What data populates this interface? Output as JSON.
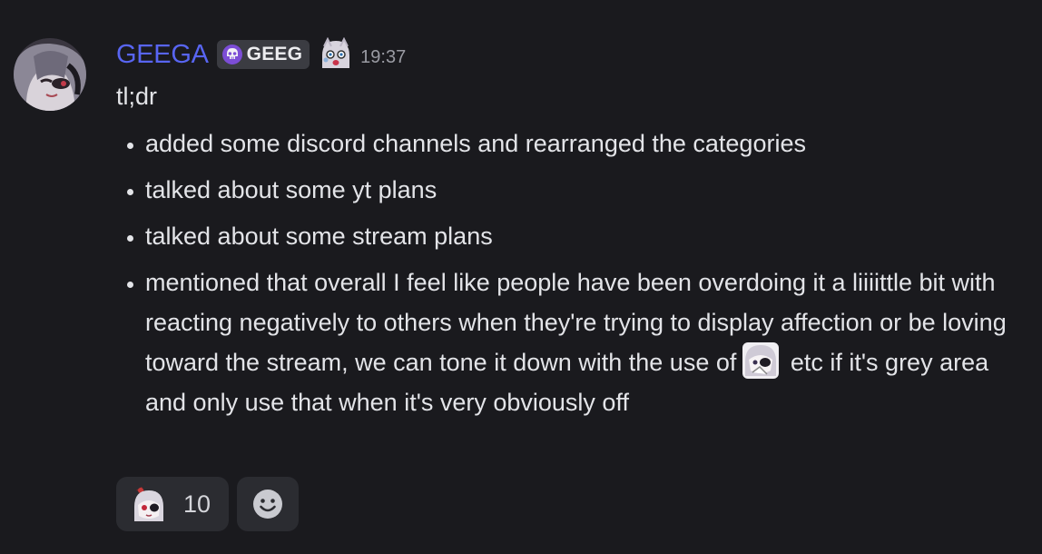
{
  "message": {
    "author": "GEEGA",
    "tag": "GEEG",
    "timestamp": "19:37",
    "intro": "tl;dr",
    "bullets": [
      "added some discord channels and rearranged the categories",
      "talked about some yt plans",
      "talked about some stream plans"
    ],
    "last_bullet_before_emoji": "mentioned that overall I feel like people have been overdoing it a liiiittle bit with reacting negatively to others when they're trying to display affection or be loving toward the stream, we can tone it down with the use of",
    "last_bullet_after_emoji": "etc if it's grey area and only use that when it's very obviously off"
  },
  "reactions": [
    {
      "emoji": "anime-girl-emoji",
      "count": "10"
    }
  ],
  "colors": {
    "background": "#1a1a1e",
    "username": "#5865f2",
    "text": "#e3e4e8",
    "timestamp": "#9a9ba3",
    "tag_bg": "#3b3c42",
    "reaction_bg": "#2b2c31"
  },
  "icons": {
    "tag": "skull-icon",
    "add_reaction": "smiley-face-icon"
  }
}
